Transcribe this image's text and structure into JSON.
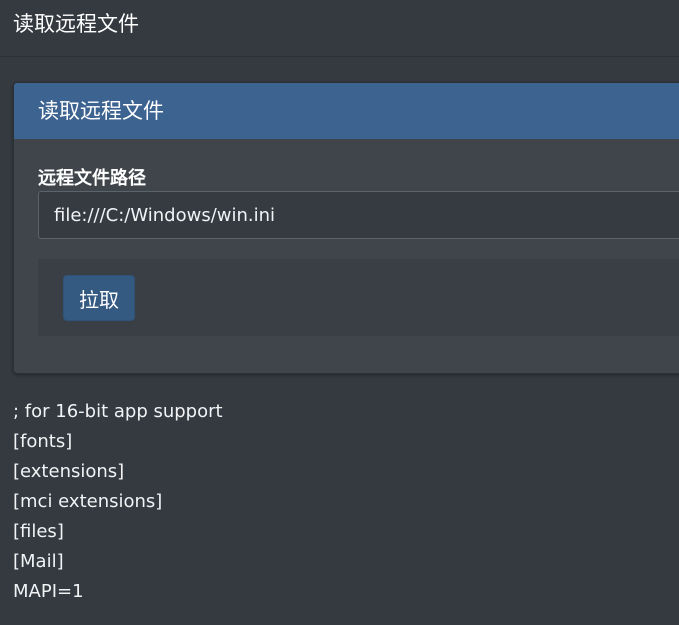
{
  "page": {
    "title": "读取远程文件"
  },
  "card": {
    "title": "读取远程文件",
    "field_label": "远程文件路径",
    "input_value": "file:///C:/Windows/win.ini",
    "button_label": "拉取"
  },
  "result": {
    "lines": [
      "; for 16-bit app support",
      "[fonts]",
      "[extensions]",
      "[mci extensions]",
      "[files]",
      "[Mail]",
      "MAPI=1"
    ]
  },
  "colors": {
    "background": "#343a40",
    "card_header": "#3d6391",
    "button": "#345a82"
  }
}
